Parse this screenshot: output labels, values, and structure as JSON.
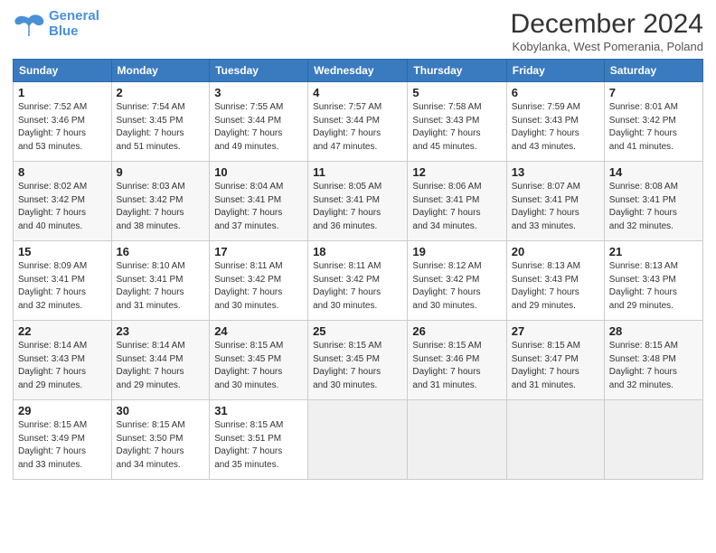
{
  "header": {
    "logo_line1": "General",
    "logo_line2": "Blue",
    "month_title": "December 2024",
    "subtitle": "Kobylanka, West Pomerania, Poland"
  },
  "days_of_week": [
    "Sunday",
    "Monday",
    "Tuesday",
    "Wednesday",
    "Thursday",
    "Friday",
    "Saturday"
  ],
  "weeks": [
    [
      {
        "day": "1",
        "info": "Sunrise: 7:52 AM\nSunset: 3:46 PM\nDaylight: 7 hours\nand 53 minutes."
      },
      {
        "day": "2",
        "info": "Sunrise: 7:54 AM\nSunset: 3:45 PM\nDaylight: 7 hours\nand 51 minutes."
      },
      {
        "day": "3",
        "info": "Sunrise: 7:55 AM\nSunset: 3:44 PM\nDaylight: 7 hours\nand 49 minutes."
      },
      {
        "day": "4",
        "info": "Sunrise: 7:57 AM\nSunset: 3:44 PM\nDaylight: 7 hours\nand 47 minutes."
      },
      {
        "day": "5",
        "info": "Sunrise: 7:58 AM\nSunset: 3:43 PM\nDaylight: 7 hours\nand 45 minutes."
      },
      {
        "day": "6",
        "info": "Sunrise: 7:59 AM\nSunset: 3:43 PM\nDaylight: 7 hours\nand 43 minutes."
      },
      {
        "day": "7",
        "info": "Sunrise: 8:01 AM\nSunset: 3:42 PM\nDaylight: 7 hours\nand 41 minutes."
      }
    ],
    [
      {
        "day": "8",
        "info": "Sunrise: 8:02 AM\nSunset: 3:42 PM\nDaylight: 7 hours\nand 40 minutes."
      },
      {
        "day": "9",
        "info": "Sunrise: 8:03 AM\nSunset: 3:42 PM\nDaylight: 7 hours\nand 38 minutes."
      },
      {
        "day": "10",
        "info": "Sunrise: 8:04 AM\nSunset: 3:41 PM\nDaylight: 7 hours\nand 37 minutes."
      },
      {
        "day": "11",
        "info": "Sunrise: 8:05 AM\nSunset: 3:41 PM\nDaylight: 7 hours\nand 36 minutes."
      },
      {
        "day": "12",
        "info": "Sunrise: 8:06 AM\nSunset: 3:41 PM\nDaylight: 7 hours\nand 34 minutes."
      },
      {
        "day": "13",
        "info": "Sunrise: 8:07 AM\nSunset: 3:41 PM\nDaylight: 7 hours\nand 33 minutes."
      },
      {
        "day": "14",
        "info": "Sunrise: 8:08 AM\nSunset: 3:41 PM\nDaylight: 7 hours\nand 32 minutes."
      }
    ],
    [
      {
        "day": "15",
        "info": "Sunrise: 8:09 AM\nSunset: 3:41 PM\nDaylight: 7 hours\nand 32 minutes."
      },
      {
        "day": "16",
        "info": "Sunrise: 8:10 AM\nSunset: 3:41 PM\nDaylight: 7 hours\nand 31 minutes."
      },
      {
        "day": "17",
        "info": "Sunrise: 8:11 AM\nSunset: 3:42 PM\nDaylight: 7 hours\nand 30 minutes."
      },
      {
        "day": "18",
        "info": "Sunrise: 8:11 AM\nSunset: 3:42 PM\nDaylight: 7 hours\nand 30 minutes."
      },
      {
        "day": "19",
        "info": "Sunrise: 8:12 AM\nSunset: 3:42 PM\nDaylight: 7 hours\nand 30 minutes."
      },
      {
        "day": "20",
        "info": "Sunrise: 8:13 AM\nSunset: 3:43 PM\nDaylight: 7 hours\nand 29 minutes."
      },
      {
        "day": "21",
        "info": "Sunrise: 8:13 AM\nSunset: 3:43 PM\nDaylight: 7 hours\nand 29 minutes."
      }
    ],
    [
      {
        "day": "22",
        "info": "Sunrise: 8:14 AM\nSunset: 3:43 PM\nDaylight: 7 hours\nand 29 minutes."
      },
      {
        "day": "23",
        "info": "Sunrise: 8:14 AM\nSunset: 3:44 PM\nDaylight: 7 hours\nand 29 minutes."
      },
      {
        "day": "24",
        "info": "Sunrise: 8:15 AM\nSunset: 3:45 PM\nDaylight: 7 hours\nand 30 minutes."
      },
      {
        "day": "25",
        "info": "Sunrise: 8:15 AM\nSunset: 3:45 PM\nDaylight: 7 hours\nand 30 minutes."
      },
      {
        "day": "26",
        "info": "Sunrise: 8:15 AM\nSunset: 3:46 PM\nDaylight: 7 hours\nand 31 minutes."
      },
      {
        "day": "27",
        "info": "Sunrise: 8:15 AM\nSunset: 3:47 PM\nDaylight: 7 hours\nand 31 minutes."
      },
      {
        "day": "28",
        "info": "Sunrise: 8:15 AM\nSunset: 3:48 PM\nDaylight: 7 hours\nand 32 minutes."
      }
    ],
    [
      {
        "day": "29",
        "info": "Sunrise: 8:15 AM\nSunset: 3:49 PM\nDaylight: 7 hours\nand 33 minutes."
      },
      {
        "day": "30",
        "info": "Sunrise: 8:15 AM\nSunset: 3:50 PM\nDaylight: 7 hours\nand 34 minutes."
      },
      {
        "day": "31",
        "info": "Sunrise: 8:15 AM\nSunset: 3:51 PM\nDaylight: 7 hours\nand 35 minutes."
      },
      {
        "day": "",
        "info": ""
      },
      {
        "day": "",
        "info": ""
      },
      {
        "day": "",
        "info": ""
      },
      {
        "day": "",
        "info": ""
      }
    ]
  ]
}
